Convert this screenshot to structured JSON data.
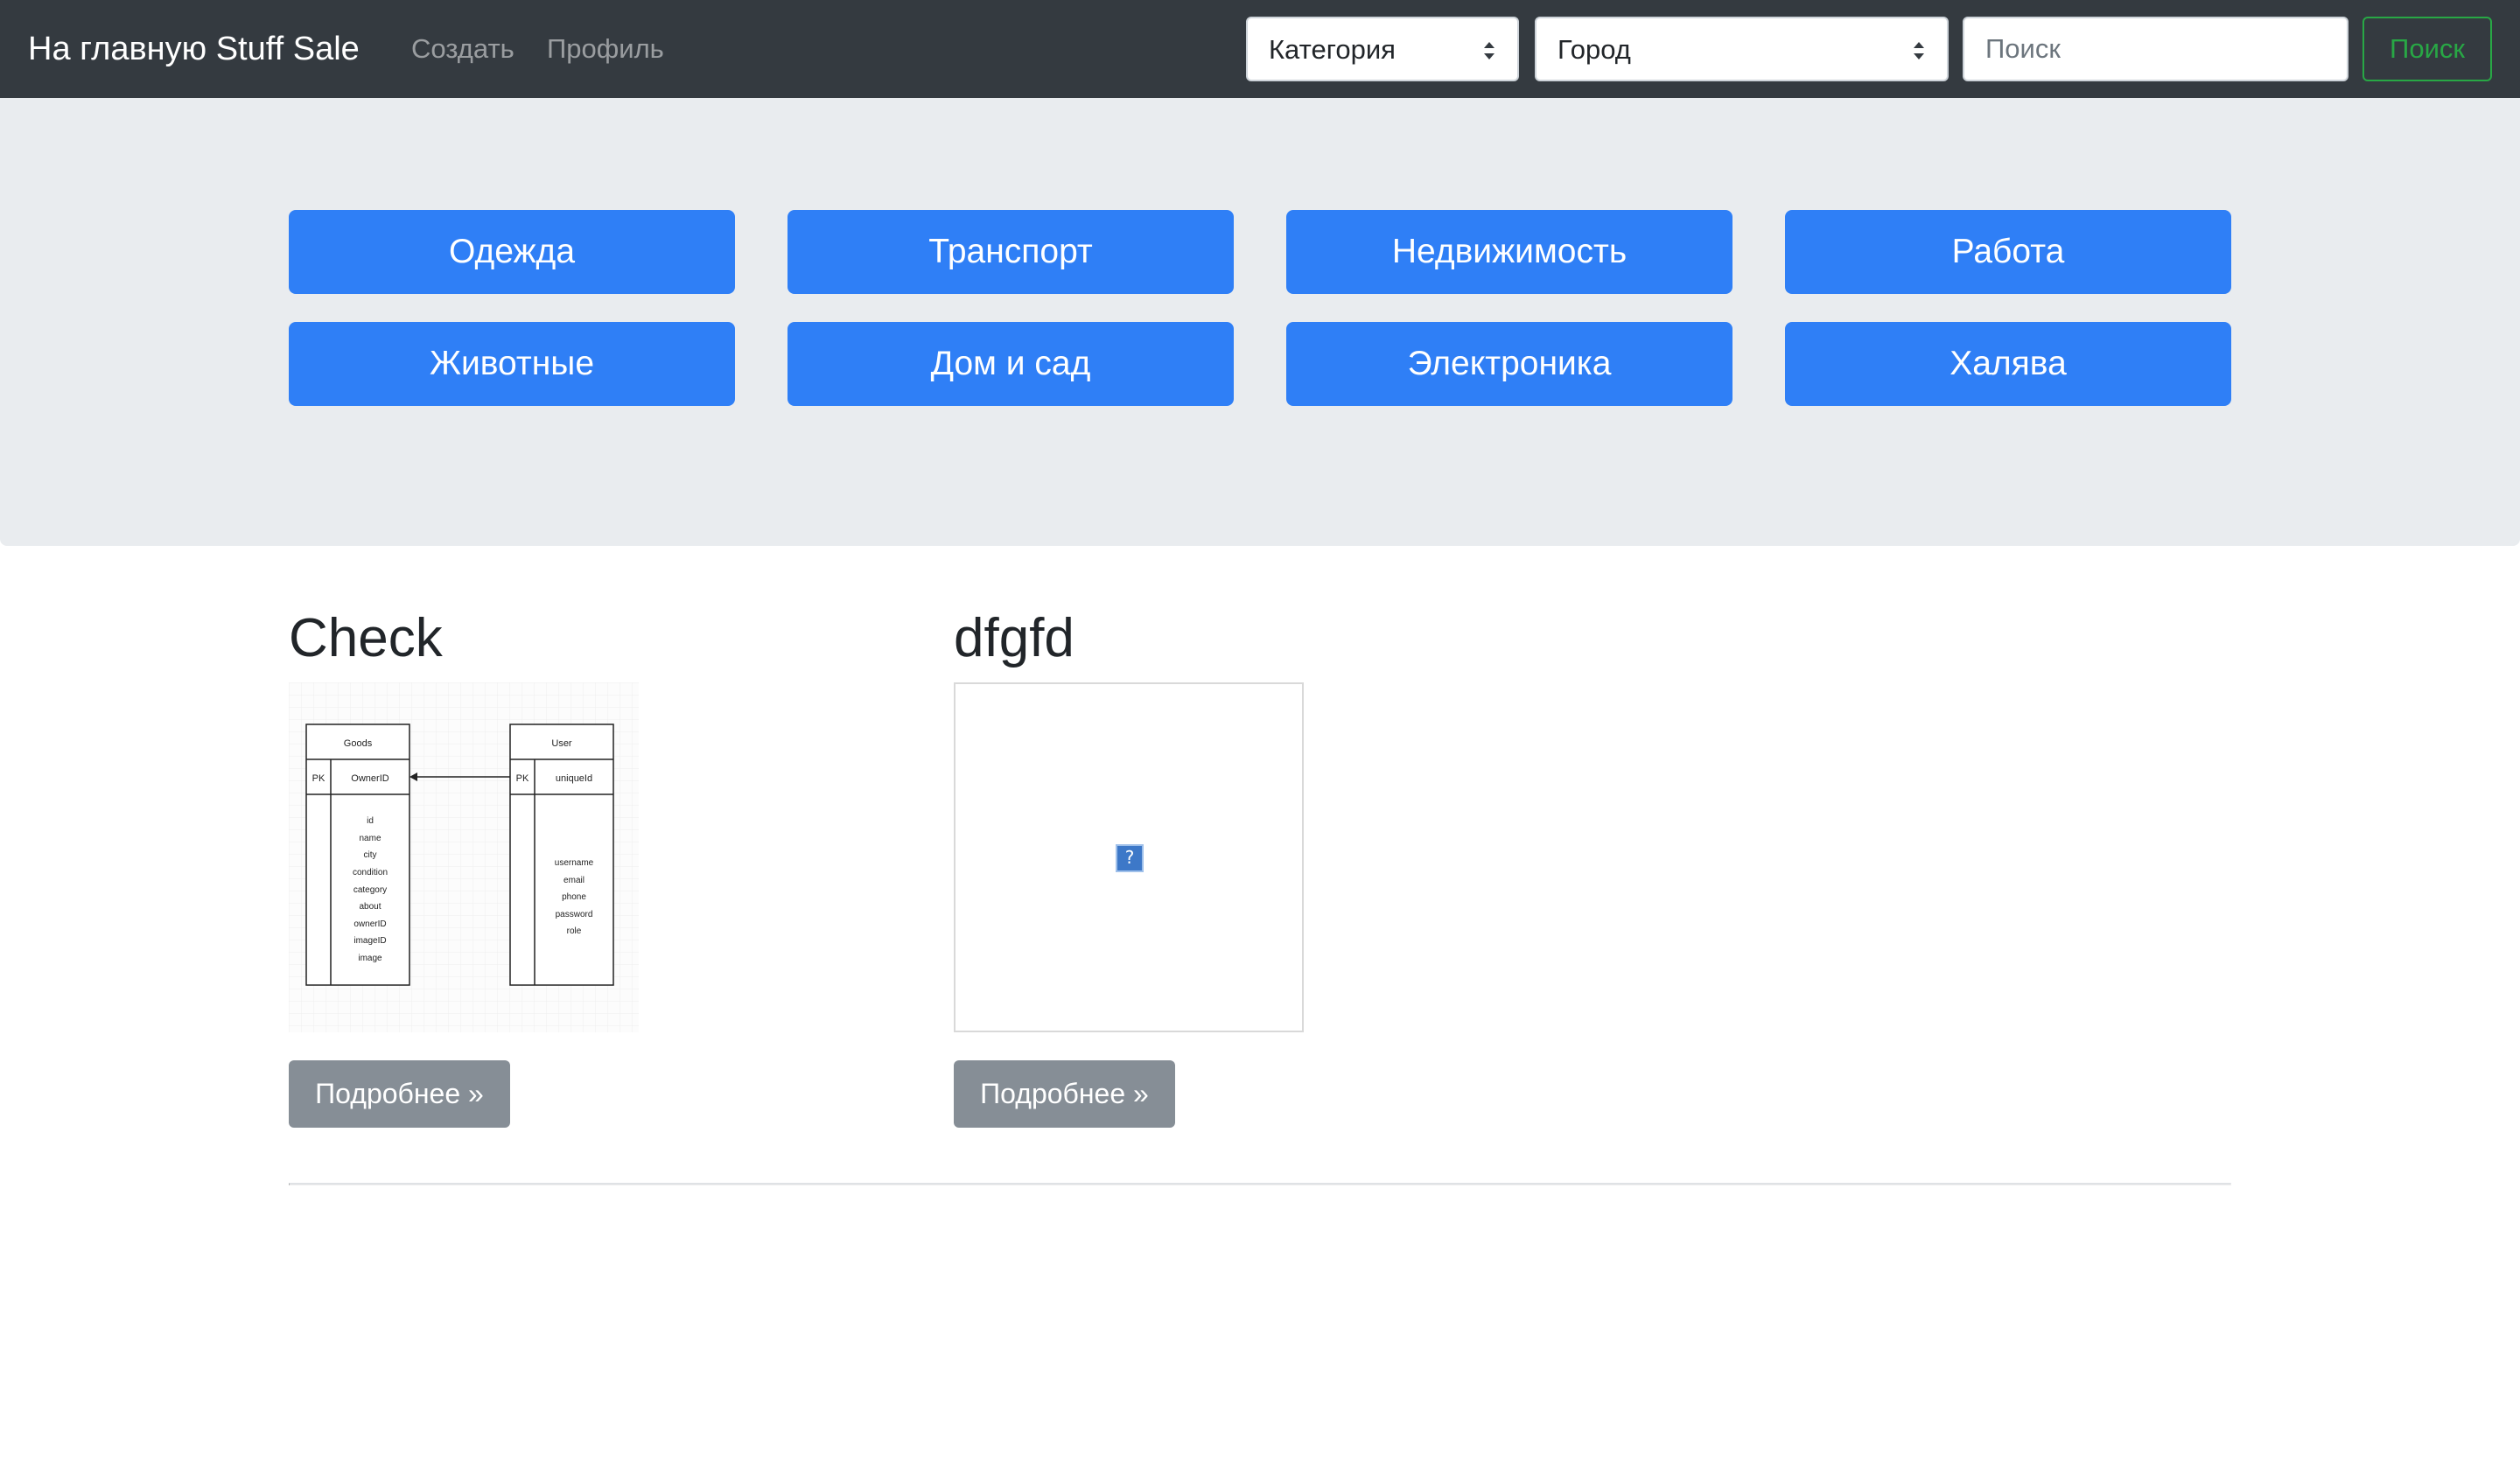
{
  "navbar": {
    "brand": "На главную Stuff Sale",
    "links": [
      "Создать",
      "Профиль"
    ],
    "category_select": "Категория",
    "city_select": "Город",
    "search_placeholder": "Поиск",
    "search_button": "Поиск"
  },
  "categories": [
    "Одежда",
    "Транспорт",
    "Недвижимость",
    "Работа",
    "Животные",
    "Дом и сад",
    "Электроника",
    "Халява"
  ],
  "items": [
    {
      "title": "Check",
      "details_button": "Подробнее »",
      "diagram": {
        "table_left": {
          "title": "Goods",
          "pk": "PK",
          "key": "OwnerID",
          "fields": [
            "id",
            "name",
            "city",
            "condition",
            "category",
            "about",
            "ownerID",
            "imageID",
            "image"
          ]
        },
        "table_right": {
          "title": "User",
          "pk": "PK",
          "key": "uniqueId",
          "fields": [
            "username",
            "email",
            "phone",
            "password",
            "role"
          ]
        }
      }
    },
    {
      "title": "dfgfd",
      "details_button": "Подробнее »",
      "broken_image_glyph": "?"
    }
  ],
  "colors": {
    "navbar": "#343a40",
    "jumbotron": "#e9ecef",
    "category_button": "#2f7ff6",
    "search_button": "#28a745",
    "details_button": "#868e96"
  },
  "icons": [
    "select-arrows-icon",
    "broken-image-icon"
  ]
}
